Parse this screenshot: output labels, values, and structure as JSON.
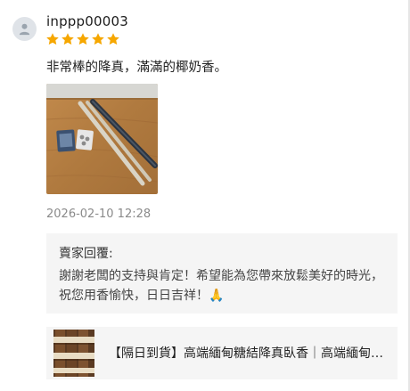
{
  "review": {
    "username": "inppp00003",
    "rating": 5,
    "comment": "非常棒的降真，滿滿的椰奶香。",
    "timestamp": "2026-02-10 12:28"
  },
  "seller_reply": {
    "title": "賣家回覆:",
    "text": "謝謝老闆的支持與肯定！希望能為您帶來放鬆美好的時光，祝您用香愉快，日日吉祥！🙏"
  },
  "product": {
    "title": "【隔日到貨】高端緬甸糖結降真臥香｜高端緬甸糖結降真臥香"
  },
  "colors": {
    "star": "#f6a700",
    "reply_bg": "#f5f5f5",
    "timestamp": "#8a8a8a"
  },
  "icons": {
    "avatar": "user-icon",
    "star": "star-icon"
  }
}
